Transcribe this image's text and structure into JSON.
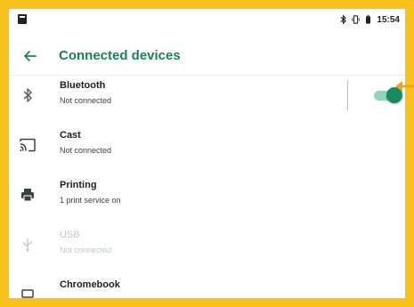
{
  "status_bar": {
    "time": "15:54",
    "icons": [
      "notification-icon",
      "bluetooth-icon",
      "vibrate-icon",
      "battery-icon"
    ]
  },
  "app_bar": {
    "title": "Connected devices",
    "back_icon": "arrow-back-icon"
  },
  "devices": [
    {
      "icon": "bluetooth-icon",
      "title": "Bluetooth",
      "subtitle": "Not connected",
      "has_toggle": true,
      "toggle_on": true,
      "enabled": true
    },
    {
      "icon": "cast-icon",
      "title": "Cast",
      "subtitle": "Not connected",
      "enabled": true
    },
    {
      "icon": "print-icon",
      "title": "Printing",
      "subtitle": "1 print service on",
      "enabled": true
    },
    {
      "icon": "usb-icon",
      "title": "USB",
      "subtitle": "Not connected",
      "enabled": false
    },
    {
      "icon": "laptop-icon",
      "title": "Chromebook",
      "subtitle": "",
      "enabled": true
    }
  ],
  "colors": {
    "accent": "#1A7F5A",
    "toggle_thumb": "#1A8A62",
    "toggle_track": "#8FD4BD",
    "frame": "#F8C21A",
    "annotation_arrow": "#F2A01B"
  }
}
